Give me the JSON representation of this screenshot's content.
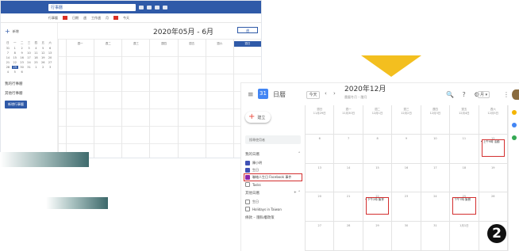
{
  "left_app": {
    "top_bar": {
      "search_text": "行事曆"
    },
    "sub_bar": {
      "items": [
        "行事曆",
        "日期",
        "週",
        "工作週",
        "月",
        "今天"
      ]
    },
    "title": "2020年05月 - 6月",
    "view_button": "週",
    "new_button": "新增",
    "mini_calendar": {
      "days": [
        "日",
        "一",
        "二",
        "三",
        "四",
        "五",
        "六",
        "31",
        "1",
        "2",
        "3",
        "4",
        "5",
        "6",
        "7",
        "8",
        "9",
        "10",
        "11",
        "12",
        "13",
        "14",
        "15",
        "16",
        "17",
        "18",
        "19",
        "20",
        "21",
        "22",
        "23",
        "24",
        "25",
        "26",
        "27",
        "28",
        "29",
        "30",
        "31",
        "1",
        "2",
        "3",
        "4",
        "5",
        "6"
      ],
      "selected_index": 36
    },
    "side_items": [
      "我的行事曆",
      "其他行事曆"
    ],
    "side_button": "新增行事曆",
    "columns": [
      "",
      "週一",
      "週二",
      "週三",
      "週四",
      "週五",
      "週六",
      "週日"
    ]
  },
  "right_app": {
    "menu_icon": "menu-icon",
    "logo_text": "31",
    "app_name": "日曆",
    "today_button": "今天",
    "nav": "‹ ›",
    "title": "2020年12月",
    "subtitle": "農曆冬月 – 臘月",
    "toolbar_icons": "🔍 ? ⚙",
    "view_select": "月 ▾",
    "apps_icon": "⋮⋮",
    "create_button": "建立",
    "search_people": "搜尋使用者",
    "my_calendars_title": "我的日曆",
    "my_calendars": [
      {
        "label": "陳小明",
        "color": "#3f51b5",
        "highlight": false
      },
      {
        "label": "生日",
        "color": "#3f51b5",
        "highlight": false
      },
      {
        "label": "聯絡人生日 Facebook 事件",
        "color": "#8e24aa",
        "highlight": true
      },
      {
        "label": "Tasks",
        "color": "#ffffff",
        "highlight": false
      }
    ],
    "other_calendars_title": "其他日曆",
    "other_calendars": [
      {
        "label": "生日",
        "color": "#ffffff"
      },
      {
        "label": "Holidays in Taiwan",
        "color": "#ffffff"
      }
    ],
    "footer": "條款 – 隱私權政策",
    "weekday_headers": [
      "週日",
      "週一",
      "週二",
      "週三",
      "週四",
      "週五",
      "週六"
    ],
    "weeks": [
      [
        "11月29日",
        "11月30日",
        "12月1日",
        "12月2日",
        "12月3日",
        "12月4日",
        "12月5日"
      ],
      [
        "6",
        "7",
        "8",
        "9",
        "10",
        "11",
        "12"
      ],
      [
        "13",
        "14",
        "15",
        "16",
        "17",
        "18",
        "19"
      ],
      [
        "20",
        "21",
        "22",
        "23",
        "24",
        "25",
        "26"
      ],
      [
        "27",
        "28",
        "29",
        "30",
        "31",
        "1月1日",
        "2"
      ]
    ],
    "events": [
      {
        "week": 1,
        "day": 6,
        "text": "• 上午9時 活動"
      },
      {
        "week": 3,
        "day": 2,
        "text": "• 下午2時 聚會"
      },
      {
        "week": 3,
        "day": 5,
        "text": "• 下午7時 聚餐"
      }
    ]
  },
  "step_badge": "2"
}
